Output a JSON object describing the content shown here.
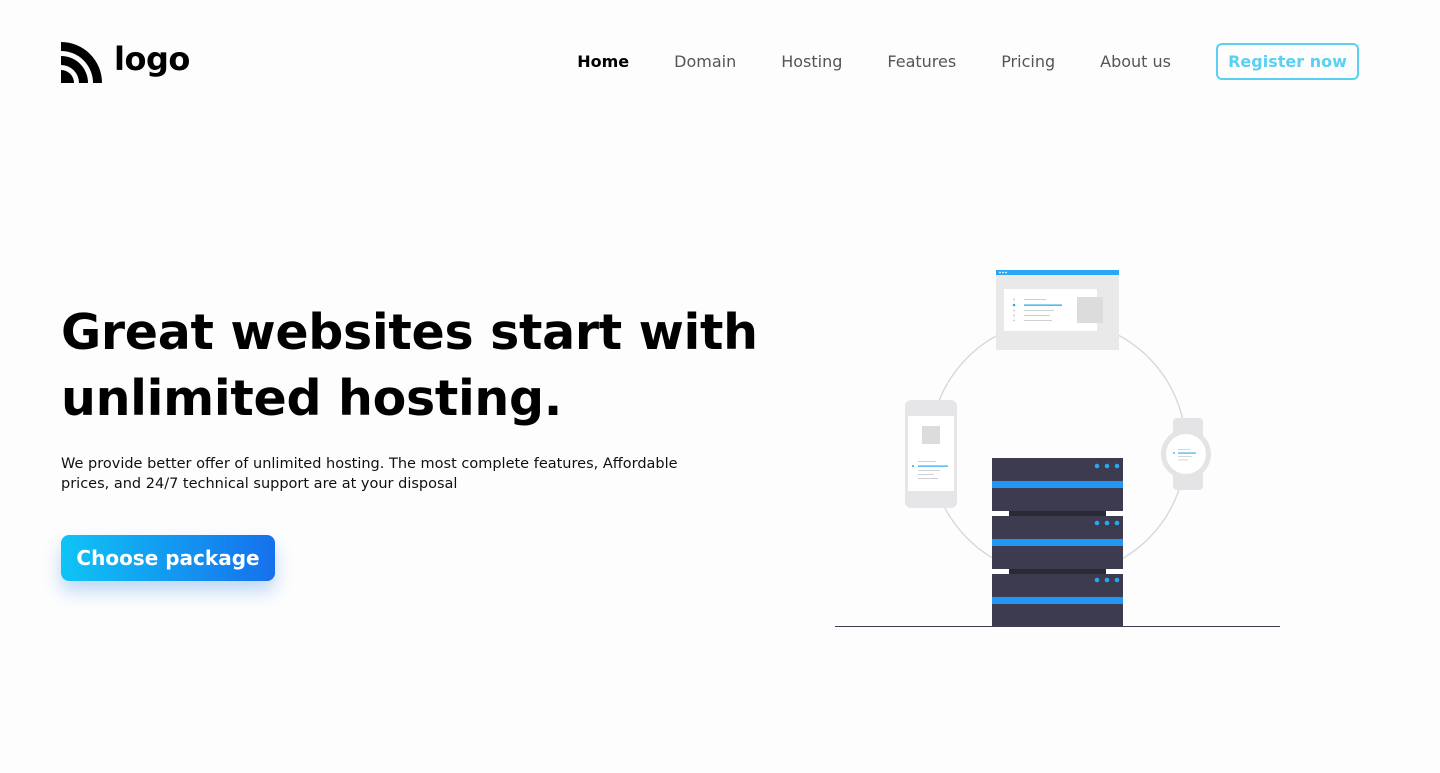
{
  "brand": {
    "logo_text": "logo"
  },
  "nav": {
    "items": [
      {
        "label": "Home",
        "active": true
      },
      {
        "label": "Domain"
      },
      {
        "label": "Hosting"
      },
      {
        "label": "Features"
      },
      {
        "label": "Pricing"
      },
      {
        "label": "About us"
      }
    ],
    "register_label": "Register now"
  },
  "hero": {
    "title_line1": "Great websites start with",
    "title_line2": "unlimited hosting.",
    "description": "We provide better offer of unlimited hosting. The most complete features, Affordable prices, and 24/7 technical support are at your disposal",
    "cta_label": "Choose package"
  },
  "colors": {
    "accent": "#1a9cf0",
    "accent_gradient_start": "#0fc4f5",
    "accent_gradient_end": "#1670ec",
    "register_border": "#5bd0f0",
    "server_body": "#3d3b50",
    "server_stripe": "#2196f3"
  },
  "icons": {
    "logo": "rss-arcs-icon"
  }
}
